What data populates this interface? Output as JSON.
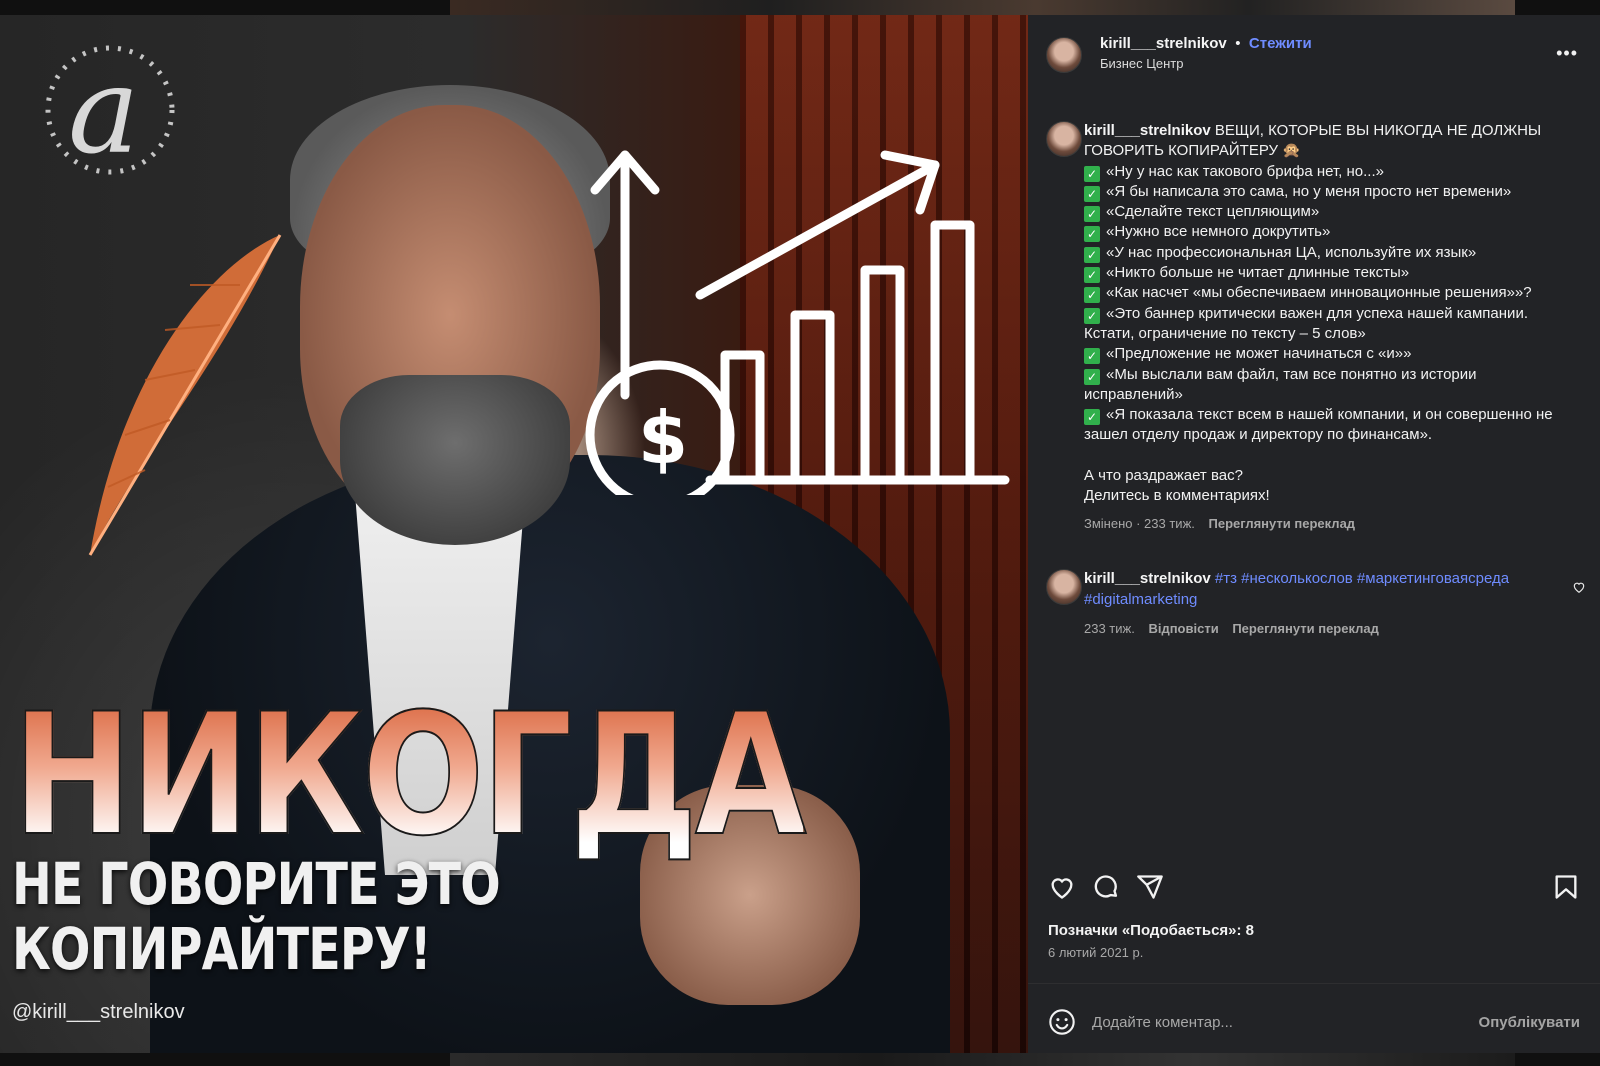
{
  "media": {
    "headline": "НИКОГДА",
    "subline_1": "НЕ ГОВОРИТЕ ЭТО",
    "subline_2": "КОПИРАЙТЕРУ!",
    "watermark": "@kirill___strelnikov"
  },
  "header": {
    "username": "kirill___strelnikov",
    "separator": "•",
    "follow_label": "Стежити",
    "location": "Бизнес Центр",
    "more_label": "•••"
  },
  "caption": {
    "username": "kirill___strelnikov",
    "title": "ВЕЩИ, КОТОРЫЕ ВЫ НИКОГДА НЕ ДОЛЖНЫ ГОВОРИТЬ КОПИРАЙТЕРУ 🙊",
    "items": [
      "«Ну у нас как такового брифа нет, но...»",
      "«Я бы написала это сама, но у меня просто нет времени»",
      "«Сделайте текст цепляющим»",
      "«Нужно все немного докрутить»",
      "«У нас профессиональная ЦА, используйте их язык»",
      "«Никто больше не читает длинные тексты»",
      "«Как насчет «мы обеспечиваем инновационные решения»»?",
      "«Это баннер критически важен для успеха нашей кампании. Кстати, ограничение по тексту – 5 слов»",
      "«Предложение не может начинаться с «и»»",
      "«Мы выслали вам файл, там все понятно из истории исправлений»",
      "«Я показала текст всем в нашей компании, и он совершенно не зашел отделу продаж и директору по финансам»."
    ],
    "question": "А что раздражает вас?",
    "cta": "Делитесь в комментариях!",
    "edited": "Змінено · 233 тиж.",
    "translate": "Переглянути переклад"
  },
  "comment": {
    "username": "kirill___strelnikov",
    "hashtags": "#тз #несколькослов #маркетинговаясреда #digitalmarketing",
    "age": "233 тиж.",
    "reply": "Відповісти",
    "translate": "Переглянути переклад"
  },
  "actions": {
    "likes": "Позначки «Подобається»: 8",
    "date": "6 лютий 2021 р."
  },
  "composer": {
    "placeholder": "Додайте коментар...",
    "publish": "Опублікувати"
  },
  "colors": {
    "panel_bg": "#222326",
    "link_blue": "#6f8cff",
    "check_green": "#31b04c"
  }
}
